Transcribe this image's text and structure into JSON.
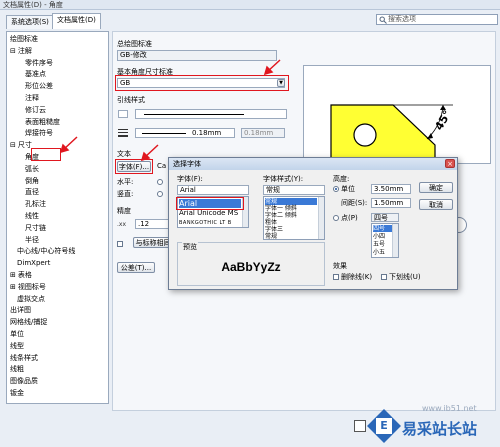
{
  "window": {
    "title": "文档属性(D) - 角度"
  },
  "tabs": [
    {
      "label": "系统选项(S)"
    },
    {
      "label": "文档属性(D)"
    }
  ],
  "search": {
    "placeholder": "搜索选项"
  },
  "tree": [
    {
      "label": "绘图标准",
      "level": 0,
      "expander": ""
    },
    {
      "label": "注解",
      "level": 0,
      "expander": "⊟"
    },
    {
      "label": "零件序号",
      "level": 2,
      "expander": ""
    },
    {
      "label": "基准点",
      "level": 2,
      "expander": ""
    },
    {
      "label": "形位公差",
      "level": 2,
      "expander": ""
    },
    {
      "label": "注释",
      "level": 2,
      "expander": ""
    },
    {
      "label": "修订云",
      "level": 2,
      "expander": ""
    },
    {
      "label": "表面粗糙度",
      "level": 2,
      "expander": ""
    },
    {
      "label": "焊接符号",
      "level": 2,
      "expander": ""
    },
    {
      "label": "尺寸",
      "level": 0,
      "expander": "⊟"
    },
    {
      "label": "角度",
      "level": 2,
      "expander": ""
    },
    {
      "label": "弧长",
      "level": 2,
      "expander": ""
    },
    {
      "label": "倒角",
      "level": 2,
      "expander": ""
    },
    {
      "label": "直径",
      "level": 2,
      "expander": ""
    },
    {
      "label": "孔标注",
      "level": 2,
      "expander": ""
    },
    {
      "label": "线性",
      "level": 2,
      "expander": ""
    },
    {
      "label": "尺寸链",
      "level": 2,
      "expander": ""
    },
    {
      "label": "半径",
      "level": 2,
      "expander": ""
    },
    {
      "label": "中心线/中心符号线",
      "level": 1,
      "expander": ""
    },
    {
      "label": "DimXpert",
      "level": 1,
      "expander": ""
    },
    {
      "label": "表格",
      "level": 0,
      "expander": "⊞"
    },
    {
      "label": "视图标号",
      "level": 0,
      "expander": "⊞"
    },
    {
      "label": "虚拟交点",
      "level": 1,
      "expander": ""
    },
    {
      "label": "出详图",
      "level": 0,
      "expander": ""
    },
    {
      "label": "网格线/捕捉",
      "level": 0,
      "expander": ""
    },
    {
      "label": "单位",
      "level": 0,
      "expander": ""
    },
    {
      "label": "线型",
      "level": 0,
      "expander": ""
    },
    {
      "label": "线条样式",
      "level": 0,
      "expander": ""
    },
    {
      "label": "线粗",
      "level": 0,
      "expander": ""
    },
    {
      "label": "图像品质",
      "level": 0,
      "expander": ""
    },
    {
      "label": "钣金",
      "level": 0,
      "expander": ""
    }
  ],
  "panel": {
    "overall_standard_label": "总绘图标准",
    "overall_standard_value": "GB-修改",
    "base_standard_label": "基本角度尺寸标准",
    "base_standard_value": "GB",
    "leader_style_label": "引线样式",
    "leader_thickness": "0.18mm",
    "leader_custom": "0.18mm",
    "text_label": "文本",
    "font_button": "字体(F)...",
    "font_name_partial": "Ca",
    "horizontal_label": "水平:",
    "vertical_label": "竖直:",
    "precision_label": "精度",
    "precision_value": ".12",
    "match_button": "与标称相同",
    "tolerance_button": "公差(T)...",
    "preview_angle": "45°"
  },
  "dialog": {
    "title": "选择字体",
    "font_label": "字体(F):",
    "font_value": "Arial",
    "font_list": [
      "Arial",
      "Arial Unicode MS",
      "BANKGOTHIC LT B"
    ],
    "style_label": "字体样式(Y):",
    "style_value": "常规",
    "style_list": [
      "常规",
      "字体一 倾斜",
      "字体二 倾斜",
      "粗体",
      "字体三",
      "常规"
    ],
    "height_label": "高度:",
    "unit_label": "单位",
    "unit_value": "3.50mm",
    "spacing_label": "间距(S):",
    "spacing_value": "1.50mm",
    "point_label": "点(P)",
    "point_value": "四号",
    "point_list": [
      "四号",
      "小四",
      "五号",
      "小五"
    ],
    "ok_button": "确定",
    "cancel_button": "取消",
    "preview_label": "预览",
    "preview_text": "AaBbYyZz",
    "effects_label": "效果",
    "strike_label": "删除线(K)",
    "underline_label": "下划线(U)"
  },
  "watermark": {
    "text": "易采站长站",
    "url": "www.ib51.net"
  },
  "colors": {
    "highlight_red": "#e0171f",
    "selection_blue": "#3a79d6",
    "preview_yellow": "#ffff33"
  }
}
